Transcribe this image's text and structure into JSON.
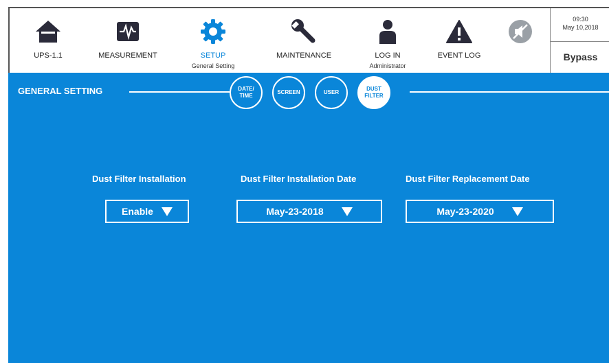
{
  "nav": {
    "items": [
      {
        "label": "UPS-1.1",
        "sub": ""
      },
      {
        "label": "MEASUREMENT",
        "sub": ""
      },
      {
        "label": "SETUP",
        "sub": "General Setting"
      },
      {
        "label": "MAINTENANCE",
        "sub": ""
      },
      {
        "label": "LOG IN",
        "sub": "Administrator"
      },
      {
        "label": "EVENT LOG",
        "sub": ""
      }
    ],
    "mute_icon": "speaker-muted-icon"
  },
  "status": {
    "time": "09:30",
    "date": "May 10,2018",
    "mode": "Bypass"
  },
  "panel": {
    "title": "GENERAL SETTING",
    "tabs": [
      {
        "line1": "DATE/",
        "line2": "TIME"
      },
      {
        "line1": "SCREEN",
        "line2": ""
      },
      {
        "line1": "USER",
        "line2": ""
      },
      {
        "line1": "DUST",
        "line2": "FILTER"
      }
    ],
    "active_tab": "DUST FILTER"
  },
  "fields": {
    "installation": {
      "label": "Dust Filter Installation",
      "value": "Enable"
    },
    "install_date": {
      "label": "Dust Filter Installation Date",
      "value": "May-23-2018"
    },
    "replace_date": {
      "label": "Dust Filter Replacement Date",
      "value": "May-23-2020"
    }
  },
  "colors": {
    "accent": "#0a86d9",
    "icon": "#2b2b3a",
    "panel_text": "#ffffff"
  }
}
